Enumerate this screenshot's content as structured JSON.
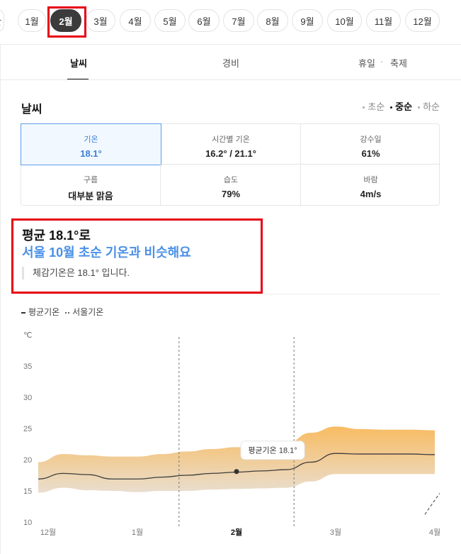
{
  "months": [
    "한",
    "1월",
    "2월",
    "3월",
    "4월",
    "5월",
    "6월",
    "7월",
    "8월",
    "9월",
    "10월",
    "11월",
    "12월"
  ],
  "active_month": "2월",
  "tabs": {
    "weather": "날씨",
    "cost": "경비",
    "holiday": "휴일",
    "festival": "축제",
    "separator": "·"
  },
  "section_title": "날씨",
  "period": {
    "early": "초순",
    "mid": "중순",
    "late": "하순"
  },
  "stats": {
    "temp": {
      "label": "기온",
      "value": "18.1°"
    },
    "hourly": {
      "label": "시간별 기온",
      "value": "16.2° / 21.1°"
    },
    "rain": {
      "label": "강수일",
      "value": "61%"
    },
    "cloud": {
      "label": "구름",
      "value": "대부분 맑음"
    },
    "humidity": {
      "label": "습도",
      "value": "79%"
    },
    "wind": {
      "label": "바람",
      "value": "4m/s"
    }
  },
  "summary": {
    "title": "평균 18.1°로",
    "subtitle": "서울 10월 초순 기온과 비슷해요",
    "feels_like": "체감기온은 18.1° 입니다."
  },
  "legend": {
    "avg": "평균기온",
    "seoul": "서울기온"
  },
  "chart_data": {
    "type": "area",
    "unit": "℃",
    "ylim": [
      10,
      37
    ],
    "yticks": [
      10,
      15,
      20,
      25,
      30,
      35
    ],
    "x_labels": [
      "12월",
      "1월",
      "2월",
      "3월",
      "4월"
    ],
    "x_label_positions": [
      0,
      1,
      2,
      3,
      4
    ],
    "series": [
      {
        "name": "평균기온",
        "x": [
          0,
          0.25,
          0.5,
          0.75,
          1,
          1.25,
          1.5,
          1.75,
          2,
          2.25,
          2.5,
          2.75,
          3,
          3.25,
          3.5,
          3.75,
          4
        ],
        "values": [
          16.9,
          17.8,
          17.6,
          16.9,
          16.9,
          17.2,
          17.5,
          17.8,
          18.0,
          18.2,
          18.4,
          19.6,
          21.0,
          20.9,
          20.9,
          20.9,
          20.8
        ]
      }
    ],
    "range": {
      "high": [
        19.6,
        20.9,
        20.7,
        20.5,
        20.5,
        20.9,
        21.3,
        21.7,
        22.0,
        22.3,
        22.6,
        24.3,
        25.3,
        24.9,
        24.8,
        24.8,
        24.7
      ],
      "low": [
        14.7,
        15.5,
        15.1,
        15.0,
        14.8,
        15.0,
        15.0,
        15.2,
        15.3,
        15.4,
        15.5,
        16.5,
        17.7,
        17.7,
        17.7,
        17.7,
        17.7
      ]
    },
    "marker": {
      "x": 2,
      "value": 18.1,
      "label": "평균기온 18.1°"
    },
    "seoul_tail": {
      "x": [
        3.9,
        4.05
      ],
      "values": [
        11.2,
        14.6
      ]
    },
    "bold_label": "2월"
  }
}
